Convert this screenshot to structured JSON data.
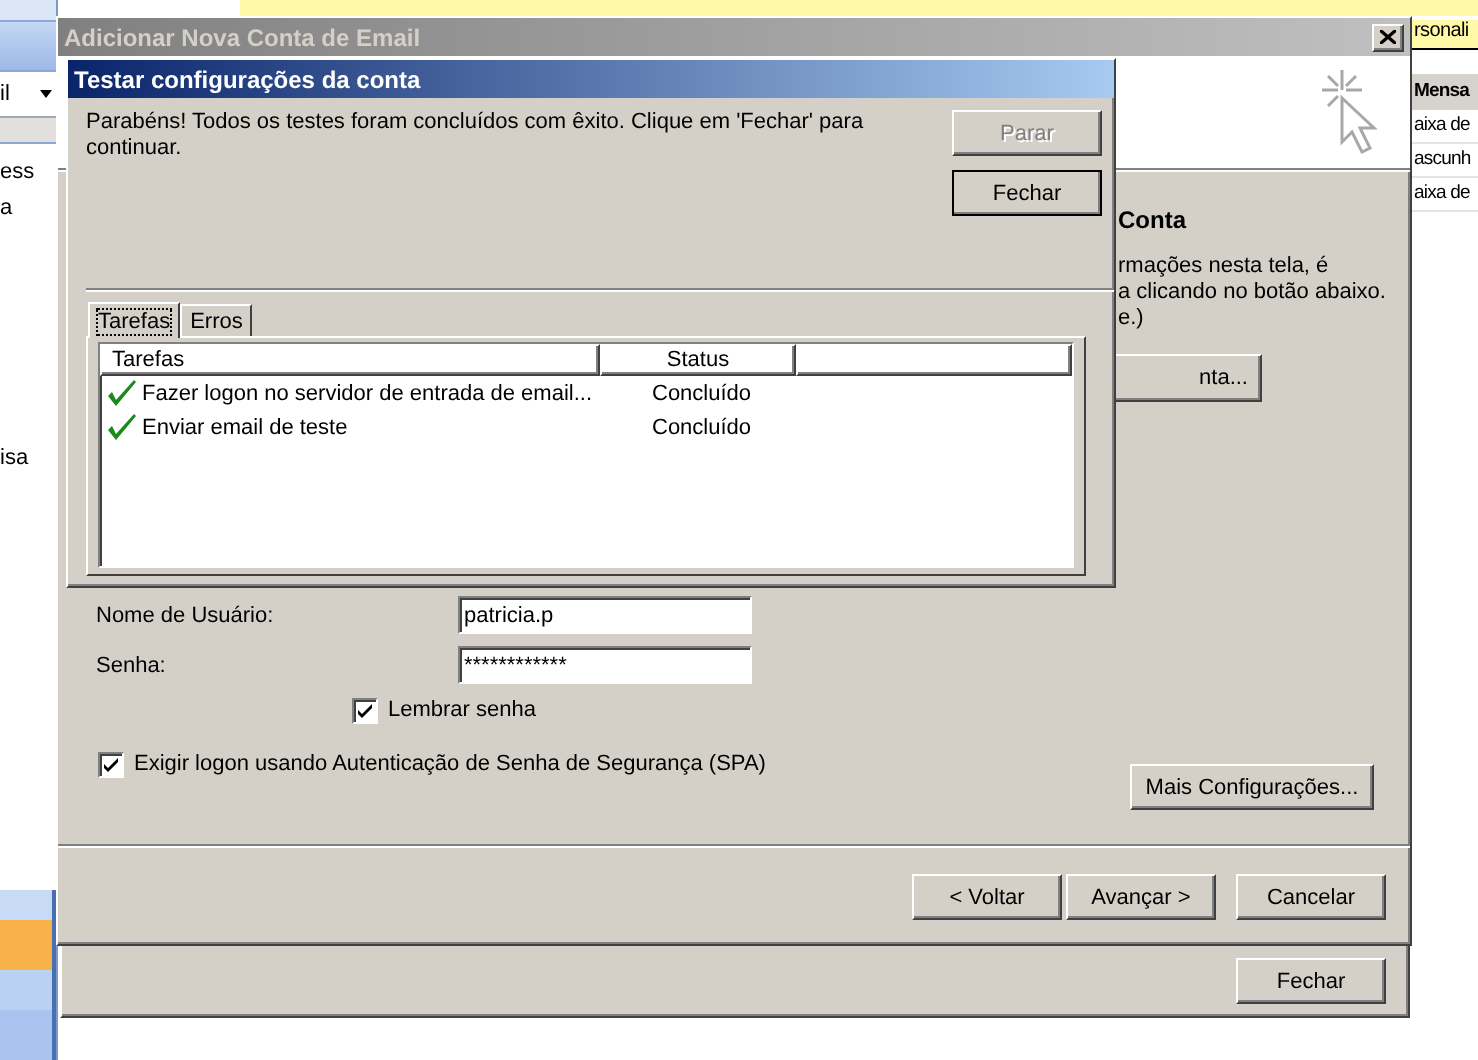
{
  "background_app": {
    "banner_text": "rsonali",
    "left_pane": {
      "folder_label": "il",
      "items": [
        "ess",
        "a",
        "isa"
      ]
    },
    "right_pane": {
      "header": "Mensa",
      "items": [
        "aixa de",
        "ascunh",
        "aixa de"
      ]
    }
  },
  "account_window": {
    "close_button": "Fechar"
  },
  "wizard": {
    "title": "Adicionar Nova Conta de Email",
    "section_title": "Conta",
    "description_lines": [
      "rmações nesta tela, é",
      "a clicando no botão abaixo.",
      "e.)"
    ],
    "account_button": "nta...",
    "fields": [
      {
        "label": "Nome de Usuário:",
        "value": "patricia.p"
      },
      {
        "label": "Senha:",
        "value": "************"
      }
    ],
    "checkboxes": [
      {
        "label": "Lembrar senha",
        "checked": true
      },
      {
        "label": "Exigir logon usando Autenticação de Senha de Segurança (SPA)",
        "checked": true
      }
    ],
    "more_button": "Mais Configurações...",
    "buttons": [
      "< Voltar",
      "Avançar >",
      "Cancelar"
    ]
  },
  "test_dialog": {
    "title": "Testar configurações da conta",
    "message": "Parabéns! Todos os testes foram concluídos com êxito. Clique em 'Fechar' para continuar.",
    "buttons": [
      {
        "label": "Parar",
        "disabled": true,
        "default": false
      },
      {
        "label": "Fechar",
        "disabled": false,
        "default": true
      }
    ],
    "tabs": [
      {
        "label": "Tarefas",
        "selected": true
      },
      {
        "label": "Erros",
        "selected": false
      }
    ],
    "columns": [
      "Tarefas",
      "Status"
    ],
    "rows": [
      {
        "task": "Fazer logon no servidor de entrada de email...",
        "status": "Concluído",
        "done": true
      },
      {
        "task": "Enviar email de teste",
        "status": "Concluído",
        "done": true
      }
    ]
  }
}
